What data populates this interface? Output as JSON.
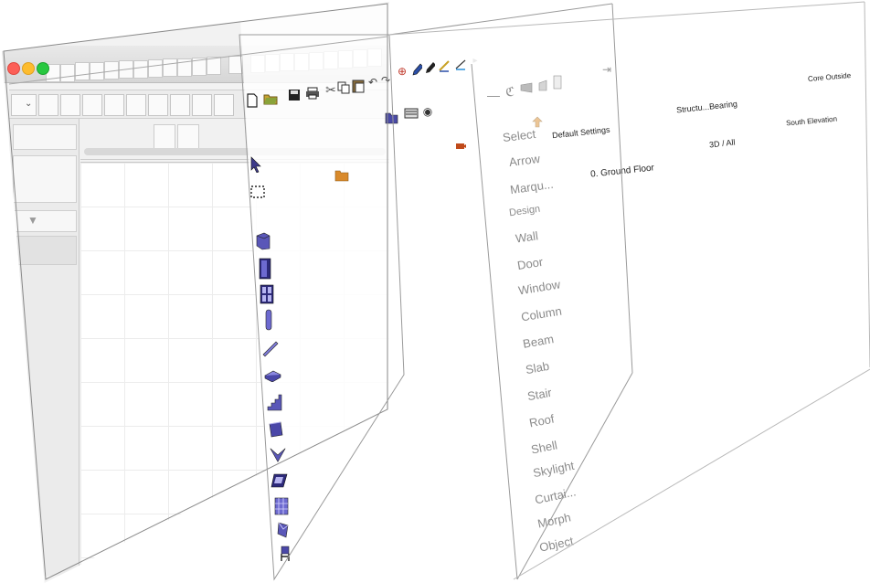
{
  "window": {
    "traffic_lights": [
      "close",
      "minimize",
      "zoom"
    ]
  },
  "toolbox": {
    "select_label": "Select",
    "tools": [
      {
        "label": "Arrow",
        "icon": "arrow-icon"
      },
      {
        "label": "Marqu...",
        "icon": "marquee-icon"
      }
    ],
    "design_label": "Design",
    "design_tools": [
      {
        "label": "Wall",
        "icon": "wall-icon"
      },
      {
        "label": "Door",
        "icon": "door-icon"
      },
      {
        "label": "Window",
        "icon": "window-icon"
      },
      {
        "label": "Column",
        "icon": "column-icon"
      },
      {
        "label": "Beam",
        "icon": "beam-icon"
      },
      {
        "label": "Slab",
        "icon": "slab-icon"
      },
      {
        "label": "Stair",
        "icon": "stair-icon"
      },
      {
        "label": "Roof",
        "icon": "roof-icon"
      },
      {
        "label": "Shell",
        "icon": "shell-icon"
      },
      {
        "label": "Skylight",
        "icon": "skylight-icon"
      },
      {
        "label": "Curtai...",
        "icon": "curtain-wall-icon"
      },
      {
        "label": "Morph",
        "icon": "morph-icon"
      },
      {
        "label": "Object",
        "icon": "object-icon"
      }
    ]
  },
  "info_box": {
    "default_settings": "Default Settings",
    "floor": "0. Ground Floor",
    "structure": "Structu...Bearing",
    "view_3d": "3D / All",
    "core": "Core Outside",
    "elevation": "South Elevation"
  },
  "colors": {
    "icon_blue": "#3d3a8a",
    "folder_orange": "#d98a2b",
    "close": "#fc5f57",
    "minimize": "#fdbc2e",
    "zoom": "#28c840"
  }
}
